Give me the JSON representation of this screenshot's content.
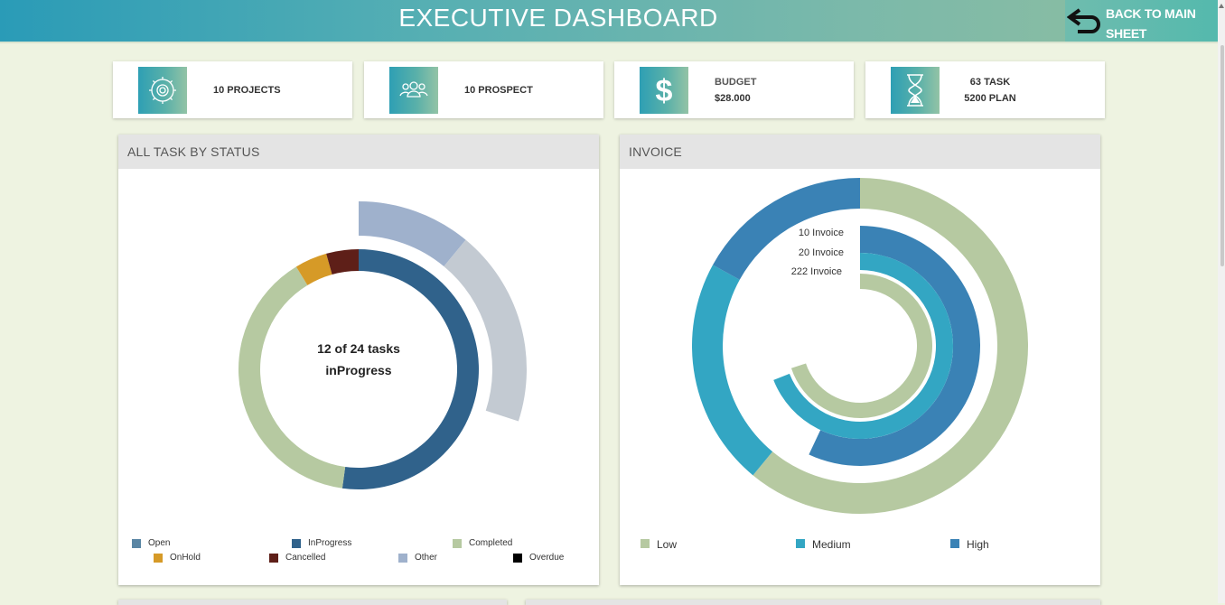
{
  "header": {
    "title": "EXECUTIVE DASHBOARD",
    "back_label_line1": "BACK TO MAIN",
    "back_label_line2": "SHEET",
    "back_icon": "undo-arrow-icon"
  },
  "kpi_cards": [
    {
      "icon": "gear-icon",
      "line1": "10 PROJECTS",
      "line2": ""
    },
    {
      "icon": "people-icon",
      "line1": "10 PROSPECT",
      "line2": ""
    },
    {
      "icon": "dollar-icon",
      "line1": "BUDGET",
      "line2": "$28.000"
    },
    {
      "icon": "hourglass-icon",
      "line1": "63 TASK",
      "line2": "5200 PLAN"
    }
  ],
  "task_panel": {
    "title": "ALL TASK BY STATUS",
    "center_line1": "12 of 24 tasks",
    "center_line2": "inProgress",
    "legend": [
      {
        "label": "Open",
        "color": "#5a86a4"
      },
      {
        "label": "InProgress",
        "color": "#30628b"
      },
      {
        "label": "Completed",
        "color": "#b6c9a1"
      },
      {
        "label": "OnHold",
        "color": "#d69a27"
      },
      {
        "label": "Cancelled",
        "color": "#5e1f18"
      },
      {
        "label": "Other",
        "color": "#9fb1cc"
      },
      {
        "label": "Overdue",
        "color": "#000000"
      }
    ]
  },
  "invoice_panel": {
    "title": "INVOICE",
    "ring_labels": [
      "10 Invoice",
      "20 Invoice",
      "222 Invoice"
    ],
    "legend": [
      {
        "label": "Low",
        "color": "#b6c9a1"
      },
      {
        "label": "Medium",
        "color": "#33a6c3"
      },
      {
        "label": "High",
        "color": "#3a82b5"
      }
    ]
  },
  "chart_data": [
    {
      "type": "pie",
      "title": "ALL TASK BY STATUS",
      "subtitle": "12 of 24 tasks inProgress",
      "categories": [
        "InProgress",
        "Completed",
        "OnHold",
        "Cancelled"
      ],
      "values": [
        12,
        9,
        1,
        1
      ],
      "outer_arc_series": [
        {
          "name": "Other",
          "fraction_of_circle": 0.11
        },
        {
          "name": "Open",
          "fraction_of_circle": 0.19
        }
      ],
      "legend": [
        "Open",
        "InProgress",
        "Completed",
        "OnHold",
        "Cancelled",
        "Other",
        "Overdue"
      ],
      "legend_position": "bottom",
      "colors": {
        "Open": "#c3cad2",
        "InProgress": "#30628b",
        "Completed": "#b6c9a1",
        "OnHold": "#d69a27",
        "Cancelled": "#5e1f18",
        "Other": "#9fb1cc",
        "Overdue": "#000000"
      }
    },
    {
      "type": "pie",
      "title": "INVOICE",
      "rings": [
        {
          "label": "",
          "segments": [
            {
              "name": "Low",
              "fraction": 0.61
            },
            {
              "name": "Medium",
              "fraction": 0.22
            },
            {
              "name": "High",
              "fraction": 0.17
            }
          ]
        },
        {
          "label": "10 Invoice",
          "segments": [
            {
              "name": "High",
              "fraction": 0.57
            }
          ]
        },
        {
          "label": "20 Invoice",
          "segments": [
            {
              "name": "Medium",
              "fraction": 0.69
            }
          ]
        },
        {
          "label": "222 Invoice",
          "segments": [
            {
              "name": "Low",
              "fraction": 0.7
            }
          ]
        }
      ],
      "legend": [
        "Low",
        "Medium",
        "High"
      ],
      "legend_position": "bottom",
      "colors": {
        "Low": "#b6c9a1",
        "Medium": "#33a6c3",
        "High": "#3a82b5"
      }
    }
  ]
}
